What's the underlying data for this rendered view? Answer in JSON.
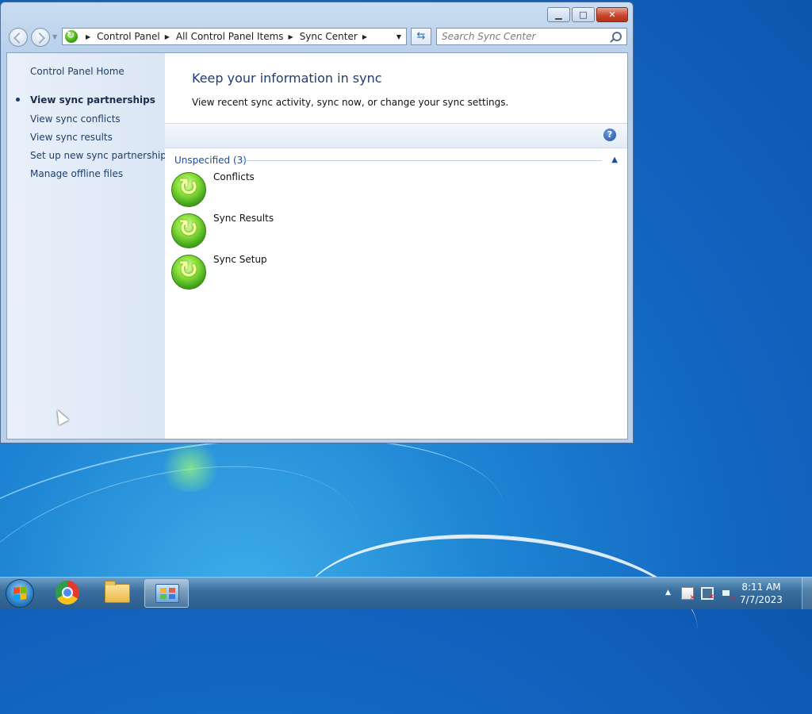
{
  "window": {
    "caption_buttons": {
      "minimize": "▁",
      "maximize": "□",
      "close": "✕"
    },
    "address": {
      "crumbs": [
        "Control Panel",
        "All Control Panel Items",
        "Sync Center"
      ],
      "separator": "▶",
      "dropdown": "▼"
    },
    "refresh_glyph": "⇆",
    "search": {
      "placeholder": "Search Sync Center"
    }
  },
  "sidebar": {
    "home": "Control Panel Home",
    "links": [
      {
        "label": "View sync partnerships",
        "active": true
      },
      {
        "label": "View sync conflicts"
      },
      {
        "label": "View sync results"
      },
      {
        "label": "Set up new sync partnerships"
      },
      {
        "label": "Manage offline files"
      }
    ]
  },
  "main": {
    "title": "Keep your information in sync",
    "description": "View recent sync activity, sync now, or change your sync settings.",
    "help_glyph": "?",
    "group": {
      "label": "Unspecified (3)",
      "collapse_glyph": "▲"
    },
    "items": [
      {
        "label": "Conflicts"
      },
      {
        "label": "Sync Results"
      },
      {
        "label": "Sync Setup"
      }
    ]
  },
  "taskbar": {
    "apps": [
      "start",
      "chrome",
      "explorer",
      "control-panel"
    ],
    "tray_arrow": "▲",
    "clock": {
      "time": "8:11 AM",
      "date": "7/7/2023"
    }
  },
  "colors": {
    "link": "#1e3f6b",
    "title": "#1f3c75",
    "group": "#1b4d9c",
    "close_button": "#c9462c"
  }
}
